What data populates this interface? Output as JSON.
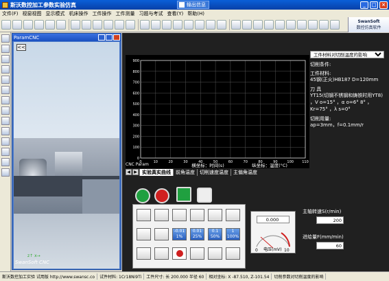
{
  "app": {
    "title": "斯沃数控加工参数实验仿真",
    "output_tab": "输出信息"
  },
  "menu": [
    "文件(F)",
    "视窗视图",
    "显示模式",
    "机床操作",
    "工件操作",
    "工件测量",
    "习题与考试",
    "查看(Y)",
    "帮助(H)"
  ],
  "brand": {
    "line1": "SwanSoft",
    "line2": "数控仿真软件"
  },
  "param_window": {
    "title": "ParamCNC",
    "back": "<<",
    "footer": "SwanSoft CNC"
  },
  "chart_data": {
    "type": "line",
    "xlabel": "横坐标：时间(s)",
    "ylabel": "纵坐标：温度(°C)",
    "x_ticks": [
      0,
      10,
      20,
      30,
      40,
      50,
      60,
      70,
      80,
      90,
      100,
      110
    ],
    "y_ticks": [
      0,
      100,
      200,
      300,
      400,
      500,
      600,
      700,
      800,
      900
    ],
    "xlim": [
      0,
      110
    ],
    "ylim": [
      0,
      900
    ],
    "grid": true,
    "series": []
  },
  "tabs": [
    "实验真实曲线",
    "前角温度",
    "切削速度温度",
    "主偏角温度"
  ],
  "cnc_param": "CNC Param",
  "side": {
    "select": "工件材料对切削温度的影响",
    "cond": "切削条件:",
    "mat_h": "工件材料:",
    "mat": "45钢(正火)HB187 D=120mm",
    "tool_h": "刀 具",
    "tool1": "YT15(切钢不锈钢和铸铁时用YT8)",
    "tool2": "，V o=15° ，α o=6° 8° ，",
    "tool3": "Kr=75° ，λ s=0°",
    "cut_h": "切削用量:",
    "cut": "ap=3mm，f=0.1mm/r"
  },
  "keys": [
    "",
    "",
    "",
    "",
    "",
    "",
    "",
    "",
    "-0.01\n1%",
    "0.01\n25%",
    "0.1\n50%",
    "1\n100%"
  ],
  "gauge": {
    "value": "0.000",
    "min": "0",
    "max": "10",
    "label": "电压(mV)"
  },
  "spindle": {
    "label": "主轴转速S(r/min)",
    "value": "200"
  },
  "feed": {
    "label": "进给量F(mm/min)",
    "value": "60"
  },
  "status": [
    "斯沃数控加工实验 试用版 http://www.swansc.co",
    "试件材料: 1Cr18Ni9Ti",
    "工件尺寸: 长 200.000 半径 60",
    "相对坐标: X -87.510, Z-101.54",
    "切削参数对切削温度的影响"
  ],
  "colors": {
    "accent": "#0a5fd8",
    "panel": "#202020"
  }
}
